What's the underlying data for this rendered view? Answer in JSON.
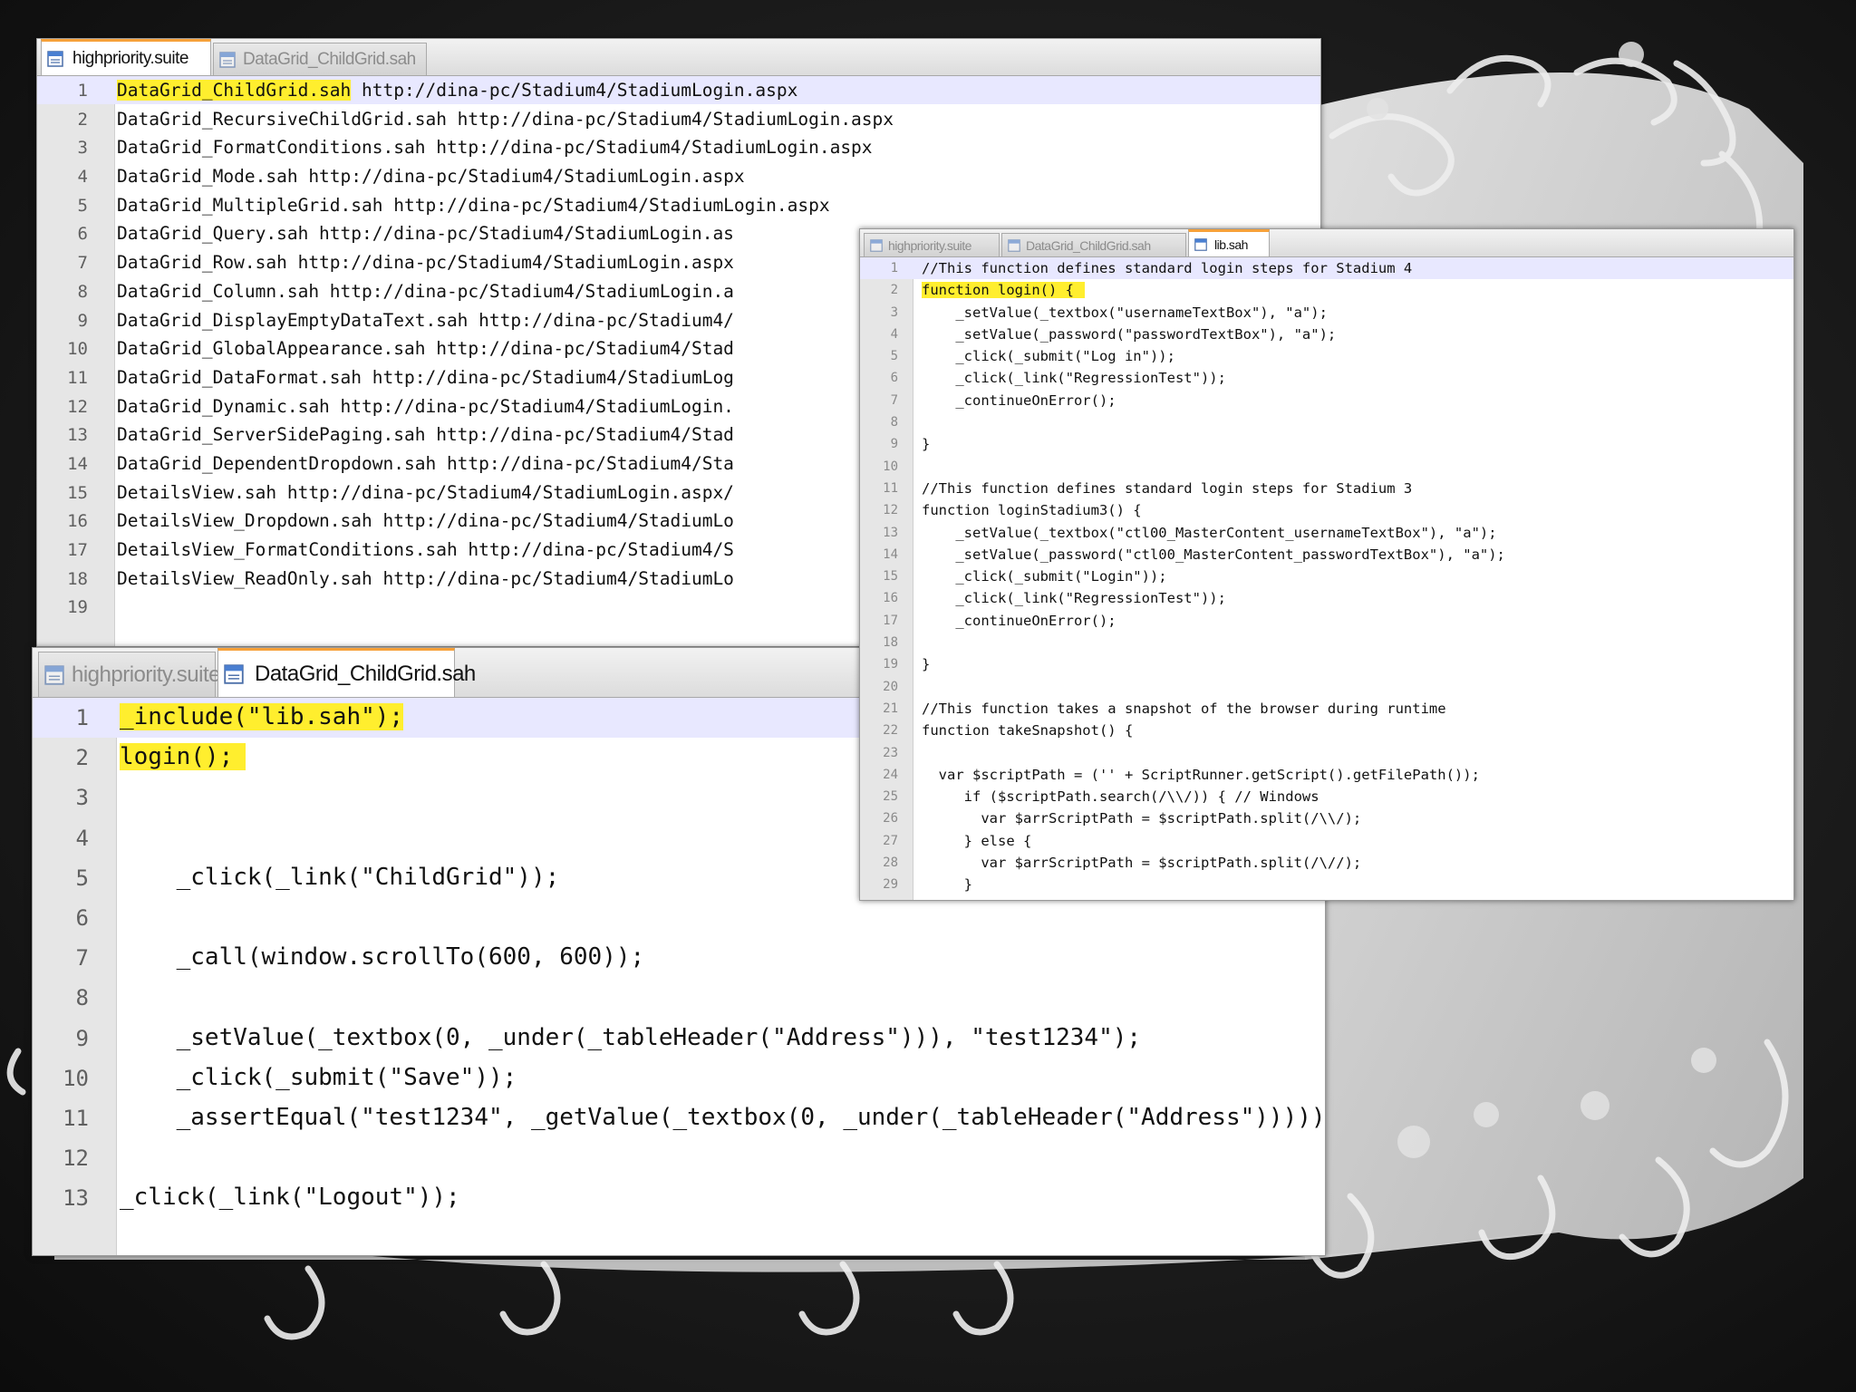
{
  "colors": {
    "highlight": "#ffee2e",
    "active_tab_accent": "#f6a13a",
    "gutter": "#e6e6e6",
    "current_line": "#e8e8ff"
  },
  "window1": {
    "tabs": [
      {
        "label": "highpriority.suite",
        "icon": "suite-file-icon",
        "active": true
      },
      {
        "label": "DataGrid_ChildGrid.sah",
        "icon": "script-file-icon",
        "active": false
      }
    ],
    "lines": [
      {
        "n": "1",
        "text": "DataGrid_ChildGrid.sah",
        "rest": " http://dina-pc/Stadium4/StadiumLogin.aspx"
      },
      {
        "n": "2",
        "text": "",
        "rest": "DataGrid_RecursiveChildGrid.sah http://dina-pc/Stadium4/StadiumLogin.aspx"
      },
      {
        "n": "3",
        "text": "",
        "rest": "DataGrid_FormatConditions.sah http://dina-pc/Stadium4/StadiumLogin.aspx"
      },
      {
        "n": "4",
        "text": "",
        "rest": "DataGrid_Mode.sah http://dina-pc/Stadium4/StadiumLogin.aspx"
      },
      {
        "n": "5",
        "text": "",
        "rest": "DataGrid_MultipleGrid.sah http://dina-pc/Stadium4/StadiumLogin.aspx"
      },
      {
        "n": "6",
        "text": "",
        "rest": "DataGrid_Query.sah http://dina-pc/Stadium4/StadiumLogin.as"
      },
      {
        "n": "7",
        "text": "",
        "rest": "DataGrid_Row.sah http://dina-pc/Stadium4/StadiumLogin.aspx"
      },
      {
        "n": "8",
        "text": "",
        "rest": "DataGrid_Column.sah http://dina-pc/Stadium4/StadiumLogin.a"
      },
      {
        "n": "9",
        "text": "",
        "rest": "DataGrid_DisplayEmptyDataText.sah http://dina-pc/Stadium4/"
      },
      {
        "n": "10",
        "text": "",
        "rest": "DataGrid_GlobalAppearance.sah http://dina-pc/Stadium4/Stad"
      },
      {
        "n": "11",
        "text": "",
        "rest": "DataGrid_DataFormat.sah http://dina-pc/Stadium4/StadiumLog"
      },
      {
        "n": "12",
        "text": "",
        "rest": "DataGrid_Dynamic.sah http://dina-pc/Stadium4/StadiumLogin."
      },
      {
        "n": "13",
        "text": "",
        "rest": "DataGrid_ServerSidePaging.sah http://dina-pc/Stadium4/Stad"
      },
      {
        "n": "14",
        "text": "",
        "rest": "DataGrid_DependentDropdown.sah http://dina-pc/Stadium4/Sta"
      },
      {
        "n": "15",
        "text": "",
        "rest": "DetailsView.sah http://dina-pc/Stadium4/StadiumLogin.aspx/"
      },
      {
        "n": "16",
        "text": "",
        "rest": "DetailsView_Dropdown.sah http://dina-pc/Stadium4/StadiumLo"
      },
      {
        "n": "17",
        "text": "",
        "rest": "DetailsView_FormatConditions.sah http://dina-pc/Stadium4/S"
      },
      {
        "n": "18",
        "text": "",
        "rest": "DetailsView_ReadOnly.sah http://dina-pc/Stadium4/StadiumLo"
      },
      {
        "n": "19",
        "text": "",
        "rest": ""
      }
    ]
  },
  "window2": {
    "tabs": [
      {
        "label": "highpriority.suite",
        "icon": "suite-file-icon",
        "active": false
      },
      {
        "label": "DataGrid_ChildGrid.sah",
        "icon": "script-file-icon",
        "active": true
      }
    ],
    "lines": [
      {
        "n": "1",
        "text": "_include(\"lib.sah\");",
        "rest": ""
      },
      {
        "n": "2",
        "text": "login();",
        "rest": ""
      },
      {
        "n": "3",
        "text": "",
        "rest": ""
      },
      {
        "n": "4",
        "text": "",
        "rest": ""
      },
      {
        "n": "5",
        "text": "",
        "rest": "    _click(_link(\"ChildGrid\"));"
      },
      {
        "n": "6",
        "text": "",
        "rest": ""
      },
      {
        "n": "7",
        "text": "",
        "rest": "    _call(window.scrollTo(600, 600));"
      },
      {
        "n": "8",
        "text": "",
        "rest": ""
      },
      {
        "n": "9",
        "text": "",
        "rest": "    _setValue(_textbox(0, _under(_tableHeader(\"Address\"))), \"test1234\");"
      },
      {
        "n": "10",
        "text": "",
        "rest": "    _click(_submit(\"Save\"));"
      },
      {
        "n": "11",
        "text": "",
        "rest": "    _assertEqual(\"test1234\", _getValue(_textbox(0, _under(_tableHeader(\"Address\")))));"
      },
      {
        "n": "12",
        "text": "",
        "rest": ""
      },
      {
        "n": "13",
        "text": "",
        "rest": "_click(_link(\"Logout\"));"
      }
    ]
  },
  "window3": {
    "tabs": [
      {
        "label": "highpriority.suite",
        "icon": "suite-file-icon",
        "active": false
      },
      {
        "label": "DataGrid_ChildGrid.sah",
        "icon": "script-file-icon",
        "active": false
      },
      {
        "label": "lib.sah",
        "icon": "script-file-icon",
        "active": true
      }
    ],
    "lines": [
      {
        "n": "1",
        "text": "",
        "rest": "//This function defines standard login steps for Stadium 4"
      },
      {
        "n": "2",
        "text": "function login() {",
        "rest": ""
      },
      {
        "n": "3",
        "text": "",
        "rest": "    _setValue(_textbox(\"usernameTextBox\"), \"a\");"
      },
      {
        "n": "4",
        "text": "",
        "rest": "    _setValue(_password(\"passwordTextBox\"), \"a\");"
      },
      {
        "n": "5",
        "text": "",
        "rest": "    _click(_submit(\"Log in\"));"
      },
      {
        "n": "6",
        "text": "",
        "rest": "    _click(_link(\"RegressionTest\"));"
      },
      {
        "n": "7",
        "text": "",
        "rest": "    _continueOnError();"
      },
      {
        "n": "8",
        "text": "",
        "rest": ""
      },
      {
        "n": "9",
        "text": "",
        "rest": "}"
      },
      {
        "n": "10",
        "text": "",
        "rest": ""
      },
      {
        "n": "11",
        "text": "",
        "rest": "//This function defines standard login steps for Stadium 3"
      },
      {
        "n": "12",
        "text": "",
        "rest": "function loginStadium3() {"
      },
      {
        "n": "13",
        "text": "",
        "rest": "    _setValue(_textbox(\"ctl00_MasterContent_usernameTextBox\"), \"a\");"
      },
      {
        "n": "14",
        "text": "",
        "rest": "    _setValue(_password(\"ctl00_MasterContent_passwordTextBox\"), \"a\");"
      },
      {
        "n": "15",
        "text": "",
        "rest": "    _click(_submit(\"Login\"));"
      },
      {
        "n": "16",
        "text": "",
        "rest": "    _click(_link(\"RegressionTest\"));"
      },
      {
        "n": "17",
        "text": "",
        "rest": "    _continueOnError();"
      },
      {
        "n": "18",
        "text": "",
        "rest": ""
      },
      {
        "n": "19",
        "text": "",
        "rest": "}"
      },
      {
        "n": "20",
        "text": "",
        "rest": ""
      },
      {
        "n": "21",
        "text": "",
        "rest": "//This function takes a snapshot of the browser during runtime"
      },
      {
        "n": "22",
        "text": "",
        "rest": "function takeSnapshot() {"
      },
      {
        "n": "23",
        "text": "",
        "rest": ""
      },
      {
        "n": "24",
        "text": "",
        "rest": "  var $scriptPath = ('' + ScriptRunner.getScript().getFilePath());"
      },
      {
        "n": "25",
        "text": "",
        "rest": "     if ($scriptPath.search(/\\\\/)) { // Windows"
      },
      {
        "n": "26",
        "text": "",
        "rest": "       var $arrScriptPath = $scriptPath.split(/\\\\/);"
      },
      {
        "n": "27",
        "text": "",
        "rest": "     } else {"
      },
      {
        "n": "28",
        "text": "",
        "rest": "       var $arrScriptPath = $scriptPath.split(/\\//);"
      },
      {
        "n": "29",
        "text": "",
        "rest": "     }"
      }
    ]
  }
}
